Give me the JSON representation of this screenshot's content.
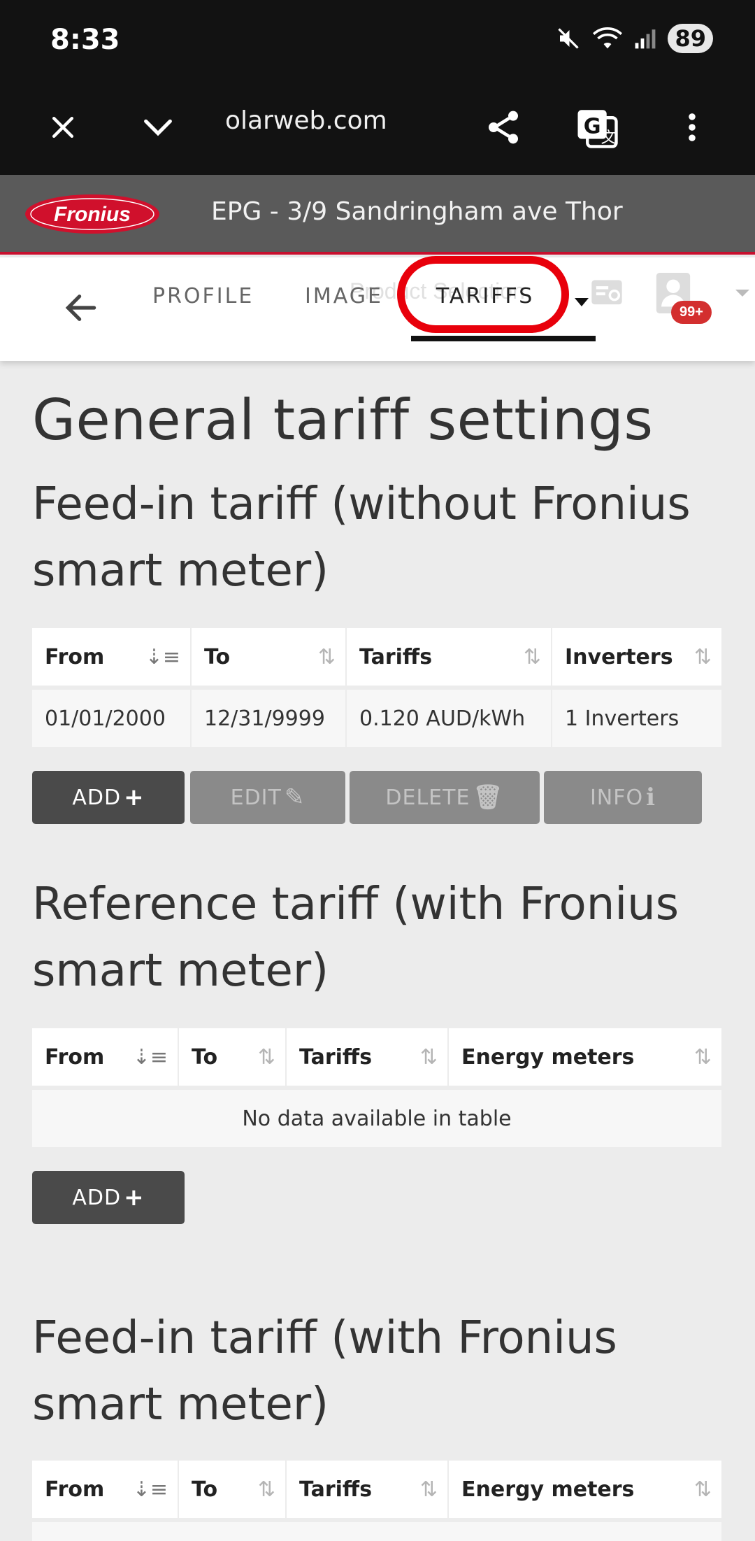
{
  "status_bar": {
    "time": "8:33",
    "battery": "89"
  },
  "browser": {
    "url": "olarweb.com"
  },
  "header": {
    "title": "EPG - 3/9 Sandringham ave Thor",
    "logo_text": "Fronius"
  },
  "tabs": [
    {
      "label": "PROFILE"
    },
    {
      "label": "IMAGE"
    },
    {
      "label": "TARIFFS"
    }
  ],
  "tab_ghost_text": "Product Selection",
  "notification_badge": "99+",
  "page_title": "General tariff settings",
  "sections": [
    {
      "title": "Feed-in tariff (without Fronius smart meter)",
      "columns": [
        "From",
        "To",
        "Tariffs",
        "Inverters"
      ],
      "rows": [
        [
          "01/01/2000",
          "12/31/9999",
          "0.120 AUD/kWh",
          "1 Inverters"
        ]
      ],
      "buttons": [
        "ADD",
        "EDIT",
        "DELETE",
        "INFO"
      ]
    },
    {
      "title": "Reference tariff (with Fronius smart meter)",
      "columns": [
        "From",
        "To",
        "Tariffs",
        "Energy meters"
      ],
      "empty_text": "No data available in table",
      "buttons": [
        "ADD"
      ]
    },
    {
      "title": "Feed-in tariff (with Fronius smart meter)",
      "columns": [
        "From",
        "To",
        "Tariffs",
        "Energy meters"
      ]
    }
  ]
}
